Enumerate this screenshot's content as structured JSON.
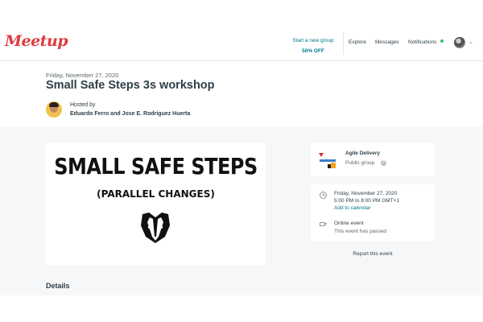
{
  "brand": {
    "logo_text": "Meetup",
    "accent": "#e0393e",
    "link_color": "#00798a"
  },
  "nav": {
    "promo_line1": "Start a new group",
    "promo_line2": "50% OFF",
    "explore": "Explore",
    "messages": "Messages",
    "notifications": "Notifications",
    "notification_dot_color": "#33c46a",
    "avatar_icon": "user-avatar",
    "caret_icon": "chevron-down-icon"
  },
  "event": {
    "date": "Friday, November 27, 2020",
    "title": "Small Safe Steps 3s workshop",
    "hosted_by_label": "Hosted by",
    "hosts": "Eduardo Ferro and Jose E. Rodriguez Huerta"
  },
  "image": {
    "title": "SMALL SAFE STEPS",
    "subtitle": "(PARALLEL CHANGES)",
    "icon": "badger-icon"
  },
  "group": {
    "name": "Agile Delivery",
    "type": "Public group",
    "info_icon": "info-icon"
  },
  "details": {
    "date": "Friday, November 27, 2020",
    "time": "5:00 PM to 8:00 PM GMT+1",
    "add_calendar": "Add to calendar",
    "online": "Online event",
    "passed": "This event has passed"
  },
  "report": "Report this event",
  "details_heading": "Details"
}
